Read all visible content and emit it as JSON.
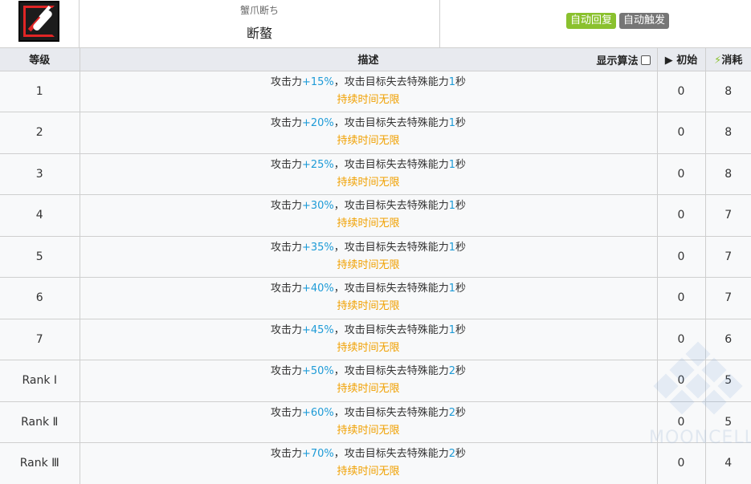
{
  "skill": {
    "icon": "crab-claw-skill-icon",
    "subtitle": "蟹爪断ち",
    "name": "断螯",
    "badges": [
      {
        "label": "自动回复",
        "color": "#8ac12e"
      },
      {
        "label": "自动触发",
        "color": "#767676"
      }
    ]
  },
  "table": {
    "headers": {
      "level": "等级",
      "description": "描述",
      "show_formula": "显示算法",
      "initial": "初始",
      "cost": "消耗"
    },
    "rows": [
      {
        "level": "1",
        "pre": "攻击力",
        "atk": "+15%",
        "mid": "，攻击目标失去特殊能力",
        "secs": "1",
        "unit": "秒",
        "duration": "持续时间无限",
        "initial": "0",
        "cost": "8"
      },
      {
        "level": "2",
        "pre": "攻击力",
        "atk": "+20%",
        "mid": "，攻击目标失去特殊能力",
        "secs": "1",
        "unit": "秒",
        "duration": "持续时间无限",
        "initial": "0",
        "cost": "8"
      },
      {
        "level": "3",
        "pre": "攻击力",
        "atk": "+25%",
        "mid": "，攻击目标失去特殊能力",
        "secs": "1",
        "unit": "秒",
        "duration": "持续时间无限",
        "initial": "0",
        "cost": "8"
      },
      {
        "level": "4",
        "pre": "攻击力",
        "atk": "+30%",
        "mid": "，攻击目标失去特殊能力",
        "secs": "1",
        "unit": "秒",
        "duration": "持续时间无限",
        "initial": "0",
        "cost": "7"
      },
      {
        "level": "5",
        "pre": "攻击力",
        "atk": "+35%",
        "mid": "，攻击目标失去特殊能力",
        "secs": "1",
        "unit": "秒",
        "duration": "持续时间无限",
        "initial": "0",
        "cost": "7"
      },
      {
        "level": "6",
        "pre": "攻击力",
        "atk": "+40%",
        "mid": "，攻击目标失去特殊能力",
        "secs": "1",
        "unit": "秒",
        "duration": "持续时间无限",
        "initial": "0",
        "cost": "7"
      },
      {
        "level": "7",
        "pre": "攻击力",
        "atk": "+45%",
        "mid": "，攻击目标失去特殊能力",
        "secs": "1",
        "unit": "秒",
        "duration": "持续时间无限",
        "initial": "0",
        "cost": "6"
      },
      {
        "level": "Rank Ⅰ",
        "pre": "攻击力",
        "atk": "+50%",
        "mid": "，攻击目标失去特殊能力",
        "secs": "2",
        "unit": "秒",
        "duration": "持续时间无限",
        "initial": "0",
        "cost": "5"
      },
      {
        "level": "Rank Ⅱ",
        "pre": "攻击力",
        "atk": "+60%",
        "mid": "，攻击目标失去特殊能力",
        "secs": "2",
        "unit": "秒",
        "duration": "持续时间无限",
        "initial": "0",
        "cost": "5"
      },
      {
        "level": "Rank Ⅲ",
        "pre": "攻击力",
        "atk": "+70%",
        "mid": "，攻击目标失去特殊能力",
        "secs": "2",
        "unit": "秒",
        "duration": "持续时间无限",
        "initial": "0",
        "cost": "4"
      }
    ]
  },
  "watermark": "MOONCELL",
  "colors": {
    "highlight": "#1e9bd7",
    "duration": "#f0a000",
    "cost_icon": "#8ac12e"
  }
}
